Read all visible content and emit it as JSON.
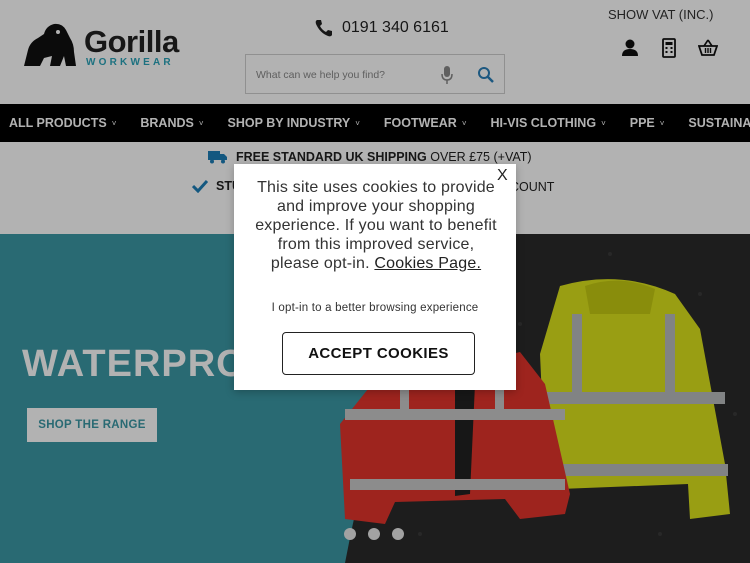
{
  "header": {
    "logo_name": "Gorilla",
    "logo_sub": "WORKWEAR",
    "phone": "0191 340 6161",
    "vat_toggle": "SHOW VAT (INC.)",
    "search": {
      "placeholder": "What can we help you find?"
    },
    "icons": [
      "account-icon",
      "calculator-icon",
      "basket-icon"
    ]
  },
  "nav": {
    "items": [
      {
        "label": "ALL PRODUCTS",
        "caret": "˅"
      },
      {
        "label": "BRANDS",
        "caret": "˅"
      },
      {
        "label": "SHOP BY INDUSTRY",
        "caret": "˅"
      },
      {
        "label": "FOOTWEAR",
        "caret": "˅"
      },
      {
        "label": "HI-VIS CLOTHING",
        "caret": "˅"
      },
      {
        "label": "PPE",
        "caret": "˅"
      },
      {
        "label": "SUSTAINABLE",
        "caret": ""
      }
    ]
  },
  "shipping": {
    "line1_bold": "FREE STANDARD UK SHIPPING",
    "line1_rest": "OVER £75 (+VAT)",
    "line2_start": "STU",
    "line2_end": "COUNT"
  },
  "hero": {
    "title": "WATERPRO",
    "button": "SHOP THE RANGE",
    "slides": 3
  },
  "cookie_modal": {
    "close": "X",
    "text": "This site uses cookies to provide and improve your shopping experience. If you want to benefit from this improved service, please opt-in.",
    "link": "Cookies Page.",
    "optin": "I opt-in to a better browsing experience",
    "accept": "ACCEPT COOKIES"
  },
  "colors": {
    "brand_teal": "#2aa3b8",
    "hero_teal": "#3b98a5",
    "nav_bg": "#000000",
    "shipping_icon": "#1e7fb8"
  }
}
